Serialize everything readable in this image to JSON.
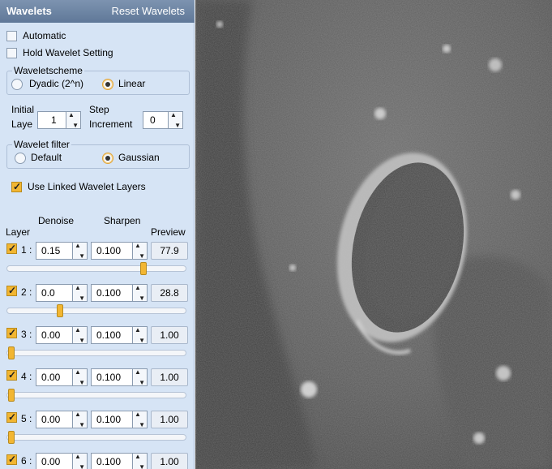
{
  "header": {
    "title": "Wavelets",
    "reset_label": "Reset Wavelets"
  },
  "options": {
    "automatic": {
      "label": "Automatic",
      "checked": false
    },
    "hold": {
      "label": "Hold Wavelet Setting",
      "checked": false
    }
  },
  "waveletscheme": {
    "legend": "Waveletscheme",
    "options": [
      {
        "label": "Dyadic (2^n)",
        "selected": false
      },
      {
        "label": "Linear",
        "selected": true
      }
    ]
  },
  "initial": {
    "label_line1": "Initial",
    "label_line2": "Laye",
    "value": "1"
  },
  "step": {
    "label_line1": "Step",
    "label_line2": "Increment",
    "value": "0"
  },
  "wavelet_filter": {
    "legend": "Wavelet filter",
    "options": [
      {
        "label": "Default",
        "selected": false
      },
      {
        "label": "Gaussian",
        "selected": true
      }
    ]
  },
  "linked": {
    "label": "Use Linked Wavelet Layers",
    "checked": true
  },
  "columns": {
    "layer": "Layer",
    "denoise": "Denoise",
    "sharpen": "Sharpen",
    "preview": "Preview"
  },
  "layers": [
    {
      "label": "1 :",
      "checked": true,
      "denoise": "0.15",
      "sharpen": "0.100",
      "preview": "77.9",
      "slider": 0.77
    },
    {
      "label": "2 :",
      "checked": true,
      "denoise": "0.0",
      "sharpen": "0.100",
      "preview": "28.8",
      "slider": 0.29
    },
    {
      "label": "3 :",
      "checked": true,
      "denoise": "0.00",
      "sharpen": "0.100",
      "preview": "1.00",
      "slider": 0.01
    },
    {
      "label": "4 :",
      "checked": true,
      "denoise": "0.00",
      "sharpen": "0.100",
      "preview": "1.00",
      "slider": 0.01
    },
    {
      "label": "5 :",
      "checked": true,
      "denoise": "0.00",
      "sharpen": "0.100",
      "preview": "1.00",
      "slider": 0.01
    },
    {
      "label": "6 :",
      "checked": true,
      "denoise": "0.00",
      "sharpen": "0.100",
      "preview": "1.00",
      "slider": 0.01
    }
  ],
  "colors": {
    "panel": "#d6e4f5",
    "accent": "#f2b632",
    "header": "#6a819f"
  }
}
